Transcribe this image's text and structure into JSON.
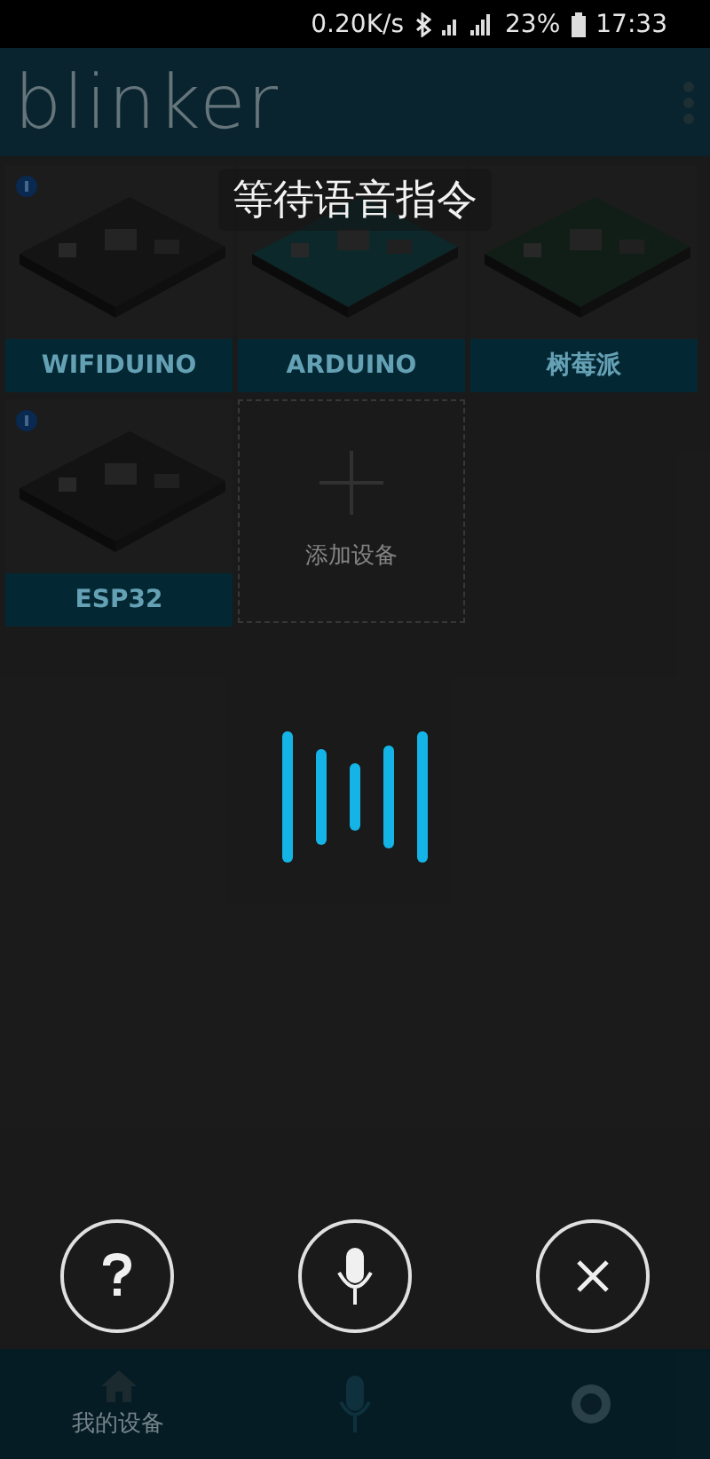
{
  "status_bar": {
    "speed": "0.20K/s",
    "battery": "23%",
    "time": "17:33"
  },
  "app_bar": {
    "title": "blinker"
  },
  "devices": [
    {
      "kind": "device",
      "label": "WIFIDUINO",
      "badge": true
    },
    {
      "kind": "device",
      "label": "ARDUINO",
      "badge": false
    },
    {
      "kind": "device",
      "label": "树莓派",
      "badge": false
    },
    {
      "kind": "device",
      "label": "ESP32",
      "badge": true
    },
    {
      "kind": "add",
      "label": "添加设备"
    }
  ],
  "voice_overlay": {
    "prompt": "等待语音指令"
  },
  "bottom_nav": [
    {
      "kind": "home",
      "label": "我的设备"
    },
    {
      "kind": "mic"
    },
    {
      "kind": "globe"
    }
  ]
}
